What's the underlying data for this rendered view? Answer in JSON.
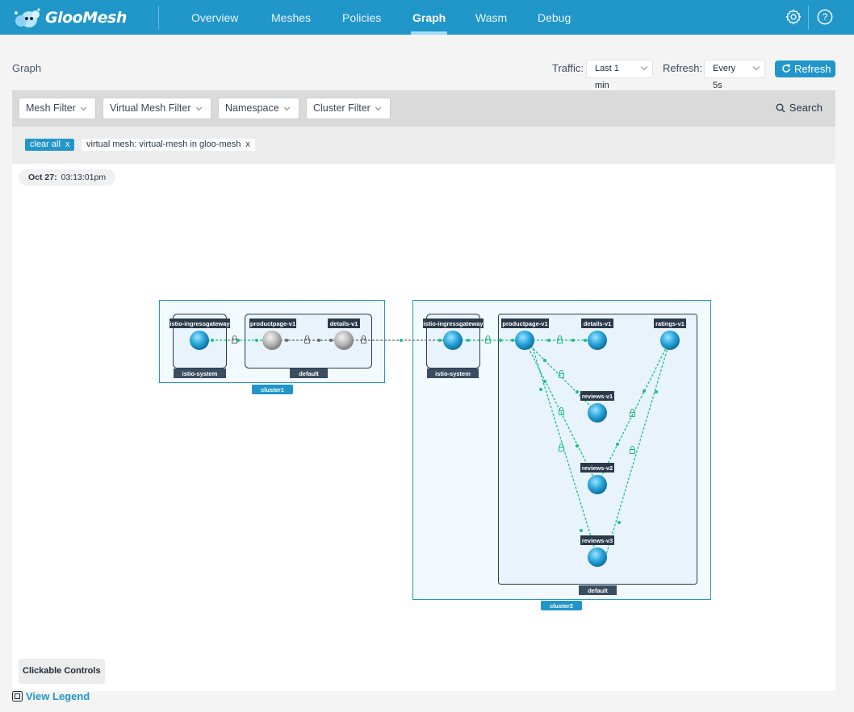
{
  "app": {
    "logo_text": "GlooMesh"
  },
  "nav": [
    {
      "label": "Overview"
    },
    {
      "label": "Meshes"
    },
    {
      "label": "Policies"
    },
    {
      "label": "Graph",
      "active": true
    },
    {
      "label": "Wasm"
    },
    {
      "label": "Debug"
    }
  ],
  "header": {
    "title": "Graph",
    "traffic_label": "Traffic:",
    "traffic_value": "Last 1 min",
    "refresh_label": "Refresh:",
    "refresh_value": "Every 5s",
    "refresh_button": "Refresh"
  },
  "filters": {
    "mesh": "Mesh Filter",
    "virtual_mesh": "Virtual Mesh Filter",
    "namespace": "Namespace",
    "cluster": "Cluster Filter",
    "search": "Search"
  },
  "chips": {
    "clear_all": "clear all",
    "active": "virtual mesh: virtual-mesh in gloo-mesh",
    "remove": "x"
  },
  "graph": {
    "timestamp_date": "Oct 27:",
    "timestamp_time": "03:13:01pm",
    "clusters": [
      {
        "name": "cluster1",
        "namespaces": [
          {
            "name": "istio-system",
            "nodes": [
              "istio-ingressgateway"
            ]
          },
          {
            "name": "default",
            "nodes": [
              "productpage-v1",
              "details-v1"
            ]
          }
        ]
      },
      {
        "name": "cluster2",
        "namespaces": [
          {
            "name": "istio-system",
            "nodes": [
              "istio-ingressgateway"
            ]
          },
          {
            "name": "default",
            "nodes": [
              "productpage-v1",
              "details-v1",
              "ratings-v1",
              "reviews-v1",
              "reviews-v2",
              "reviews-v3"
            ]
          }
        ]
      }
    ],
    "colors": {
      "edge": "#1dbf86",
      "node": "#2196c9",
      "inactive_node": "#a7a7a7",
      "label_bg": "#2b3a4a",
      "cluster_tag": "#2196c9"
    }
  },
  "footer": {
    "clickable_controls": "Clickable Controls",
    "view_legend": "View Legend"
  }
}
